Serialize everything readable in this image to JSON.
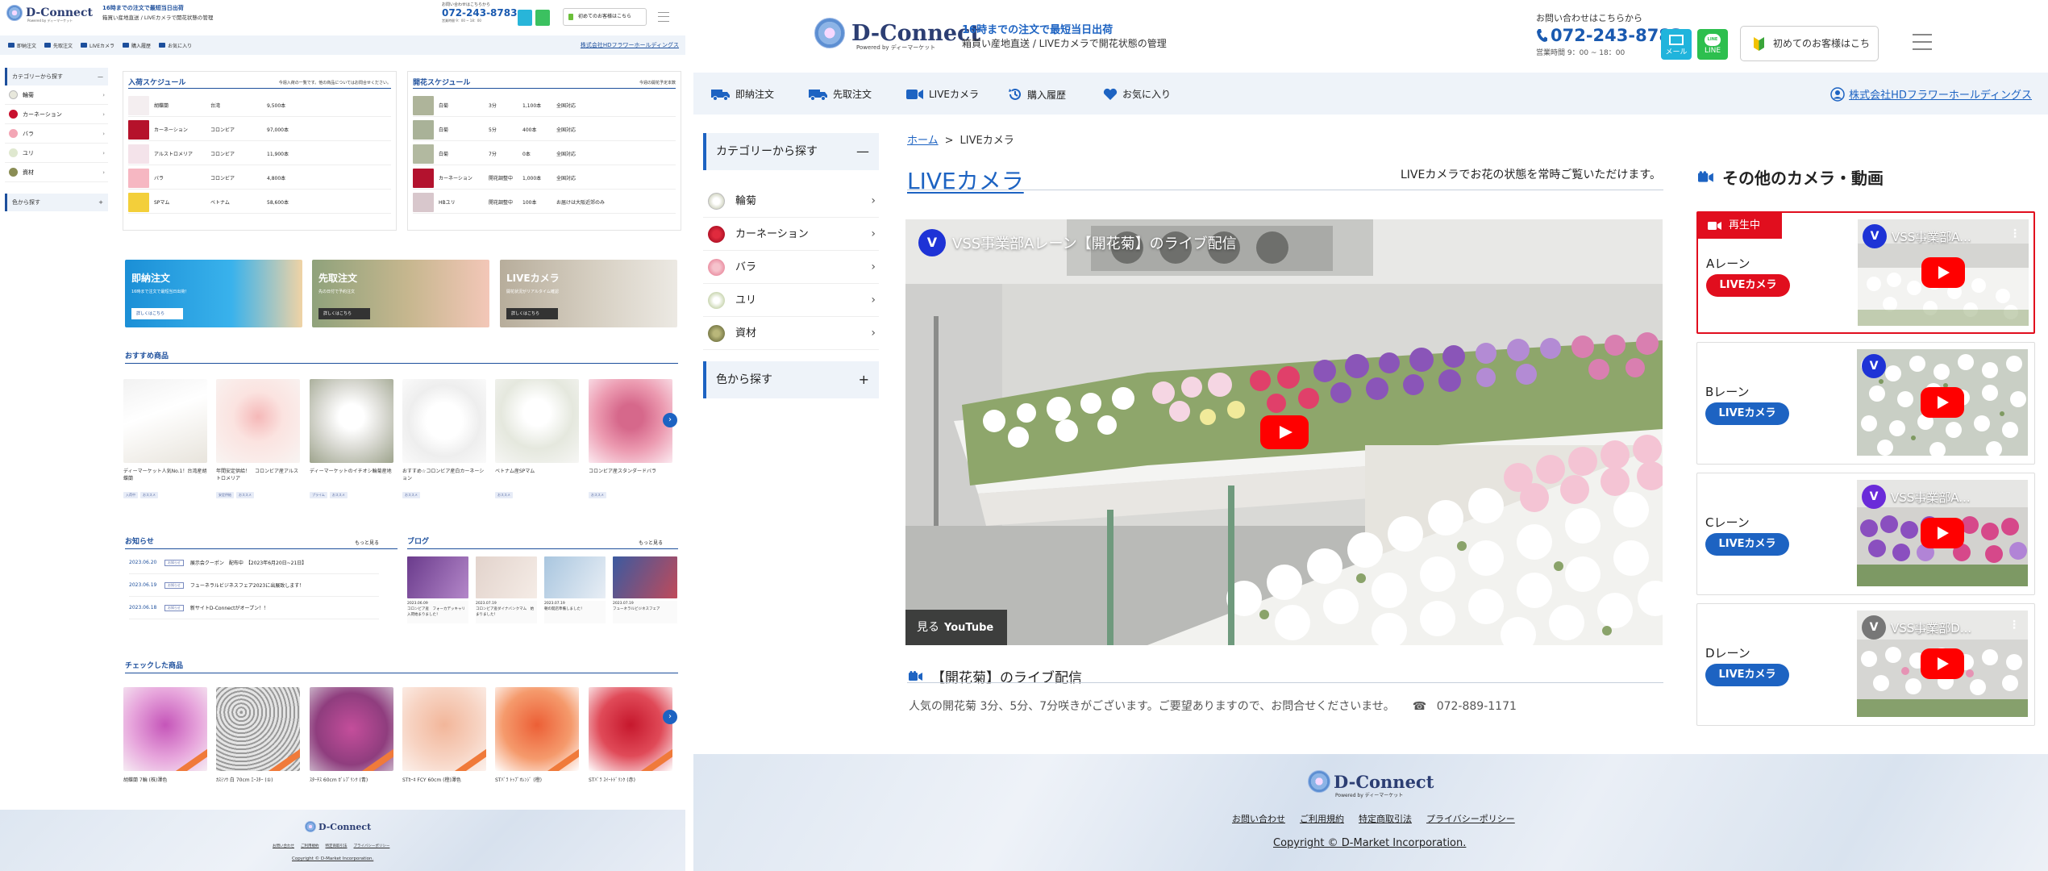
{
  "brand": {
    "name": "D-Connect",
    "powered": "Powered by ディーマーケット"
  },
  "header": {
    "tag_line1": "16時までの注文で最短当日出荷",
    "tag_line2": "箱買い産地直送 / LIVEカメラで開花状態の管理",
    "contact_q": "お問い合わせはこちらから",
    "tel": "072-243-8783",
    "hours": "営業時間 9：00 ~ 18：00",
    "mail": "メール",
    "line": "LINE",
    "first_time": "初めてのお客様はこちら"
  },
  "nav": {
    "items": [
      "即納注文",
      "先取注文",
      "LIVEカメラ",
      "購入履歴",
      "お気に入り"
    ],
    "corp": "株式会社HDフラワーホールディングス"
  },
  "sidebar": {
    "category_title": "カテゴリーから探す",
    "items": [
      "輪菊",
      "カーネーション",
      "バラ",
      "ユリ",
      "資材"
    ],
    "color_title": "色から探す"
  },
  "left_page": {
    "arrival": {
      "title": "入荷スケジュール",
      "note": "今週入荷の一覧です。他の商品についてはお問合せください。",
      "rows": [
        {
          "name": "胡蝶蘭",
          "origin": "台湾",
          "qty": "9,500本"
        },
        {
          "name": "カーネーション",
          "origin": "コロンビア",
          "qty": "97,000本"
        },
        {
          "name": "アルストロメリア",
          "origin": "コロンビア",
          "qty": "11,900本"
        },
        {
          "name": "バラ",
          "origin": "コロンビア",
          "qty": "4,800本"
        },
        {
          "name": "SPマム",
          "origin": "ベトナム",
          "qty": "58,600本"
        }
      ]
    },
    "bloom": {
      "title": "開花スケジュール",
      "note": "今週の開花予定本数",
      "rows": [
        {
          "name": "白菊",
          "stage": "3分",
          "qty": "1,100本",
          "note": "全国対応"
        },
        {
          "name": "白菊",
          "stage": "5分",
          "qty": "400本",
          "note": "全国対応"
        },
        {
          "name": "白菊",
          "stage": "7分",
          "qty": "0本",
          "note": "全国対応"
        },
        {
          "name": "カーネーション",
          "stage": "開花調整中",
          "qty": "1,000本",
          "note": "全国対応"
        },
        {
          "name": "HBユリ",
          "stage": "開花調整中",
          "qty": "100本",
          "note": "お届けは大阪近郊のみ"
        }
      ]
    },
    "banners": [
      {
        "title": "即納注文",
        "sub": "16時まで注文で最短当日出荷！",
        "btn": "詳しくはこちら"
      },
      {
        "title": "先取注文",
        "sub": "先の日付で予約注文",
        "btn": "詳しくはこちら"
      },
      {
        "title": "LIVEカメラ",
        "sub": "開花状況がリアルタイム確認",
        "btn": "詳しくはこちら"
      }
    ],
    "recommend_title": "おすすめ商品",
    "products": [
      {
        "name": "ディーマーケット人気No.1！台湾産胡蝶蘭",
        "tags": [
          "入荷中",
          "おススメ"
        ]
      },
      {
        "name": "年間安定供給！　コロンビア産アルストロメリア",
        "tags": [
          "安定供給",
          "おススメ"
        ]
      },
      {
        "name": "ディーマーケットのイチオシ輪菊産地",
        "tags": [
          "プライム",
          "おススメ"
        ]
      },
      {
        "name": "おすすめ☆コロンビア産白カーネーション",
        "tags": [
          "おススメ"
        ]
      },
      {
        "name": "ベトナム産SPマム",
        "tags": [
          "おススメ"
        ]
      },
      {
        "name": "コロンビア産スタンダードバラ",
        "tags": [
          "おススメ"
        ]
      }
    ],
    "news_title": "お知らせ",
    "news_more": "もっと見る",
    "news": [
      {
        "date": "2023.06.20",
        "cat": "お知らせ",
        "text": "展示会クーポン　配布中　【2023年6月20日~21日】"
      },
      {
        "date": "2023.06.19",
        "cat": "お知らせ",
        "text": "フューネラルビジネスフェア2023に出展致します！"
      },
      {
        "date": "2023.06.18",
        "cat": "お知らせ",
        "text": "新サイトD-Connectがオープン！！"
      }
    ],
    "blog_title": "ブログ",
    "blog_more": "もっと見る",
    "blogs": [
      {
        "date": "2023.06.09",
        "text": "コロンビア産　フォーカデッキャリ　入荷始まりました！"
      },
      {
        "date": "2023.07.19",
        "text": "コロンビア産ダイナバンクマム　始まりました！"
      },
      {
        "date": "2023.07.19",
        "text": "朝の開店準備しました！"
      },
      {
        "date": "2023.07.19",
        "text": "フューネラルビジネスフェア"
      }
    ],
    "checked_title": "チェックした商品",
    "checked": [
      "胡蝶蘭 7輪 (株)澤色",
      "ｶｽﾐｿｳ 白 70cm ｴｰｽﾀｰ (①)",
      "ｽﾀｰﾁｽ 60cm ｶﾞﾚﾌﾞﾘﾝｸ (青)",
      "STｶｰﾈ FCY 60cm (橙)澤色",
      "STﾊﾞﾗ ﾄｯﾌﾟｵﾚﾝｼﾞ (橙)",
      "STﾊﾞﾗ ｽｲｰﾄﾄﾞﾘﾝｸ (赤)"
    ]
  },
  "breadcrumb": {
    "home": "ホーム",
    "current": "LIVEカメラ"
  },
  "page": {
    "title": "LIVEカメラ",
    "lead": "LIVEカメラでお花の状態を常時ご覧いただけます。"
  },
  "video": {
    "channel_initial": "V",
    "title": "VSS事業部Aレーン【開花菊】のライブ配信",
    "watch_on": "見る",
    "youtube": "YouTube"
  },
  "live": {
    "title": "【開花菊】のライブ配信",
    "desc": "人気の開花菊 3分、5分、7分咲きがございます。ご要望ありますので、お問合せくださいませ。",
    "tel": "072-889-1171"
  },
  "others": {
    "title": "その他のカメラ・動画",
    "now_playing": "再生中",
    "btn": "LIVEカメラ",
    "cards": [
      {
        "lane": "Aレーン",
        "thumb_title": "VSS事業部A..."
      },
      {
        "lane": "Bレーン",
        "thumb_title": ""
      },
      {
        "lane": "Cレーン",
        "thumb_title": "VSS事業部A..."
      },
      {
        "lane": "Dレーン",
        "thumb_title": "VSS事業部D..."
      }
    ]
  },
  "footer": {
    "links": [
      "お問い合わせ",
      "ご利用規約",
      "特定商取引法",
      "プライバシーポリシー"
    ],
    "copyright": "Copyright © D-Market Incorporation."
  },
  "colors": {
    "brand_blue": "#1d63c2",
    "live_red": "#e10e1e",
    "nav_bg": "#eef3f9"
  }
}
